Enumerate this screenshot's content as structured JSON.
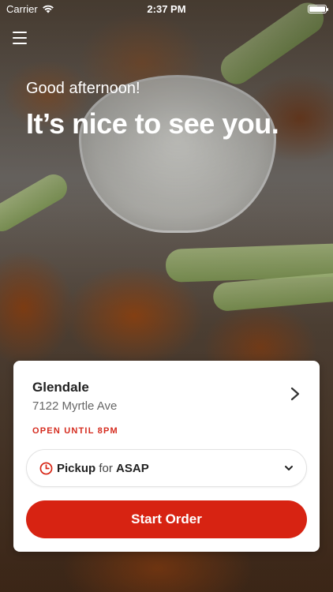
{
  "status_bar": {
    "carrier": "Carrier",
    "time": "2:37 PM"
  },
  "hero": {
    "greeting": "Good afternoon!",
    "headline": "It’s nice to see you."
  },
  "location_card": {
    "name": "Glendale",
    "address": "7122 Myrtle Ave",
    "hours": "OPEN UNTIL 8PM",
    "order_mode": {
      "method": "Pickup",
      "connector": "for",
      "time": "ASAP"
    },
    "start_order_label": "Start Order"
  },
  "colors": {
    "accent": "#d72312",
    "hours_text": "#d52b1e"
  },
  "icons": {
    "menu": "hamburger-menu-icon",
    "wifi": "wifi-icon",
    "battery": "battery-icon",
    "location_chevron": "chevron-right-icon",
    "clock": "clock-icon",
    "dropdown": "chevron-down-icon"
  }
}
